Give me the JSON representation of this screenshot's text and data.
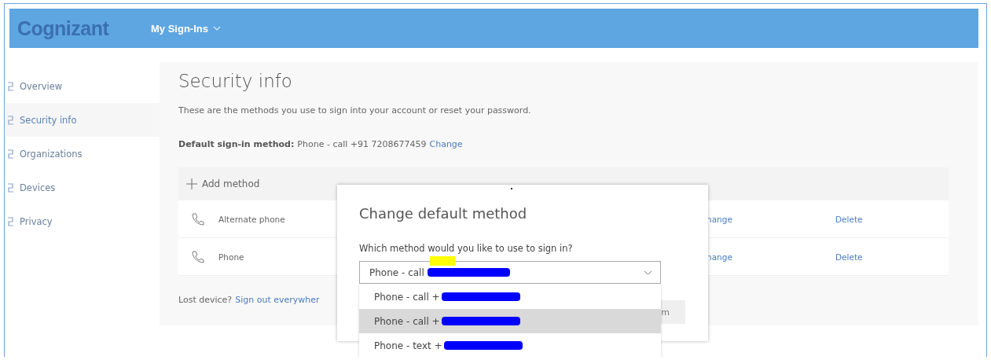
{
  "header": {
    "logo": "Cognizant",
    "app_menu": "My Sign-Ins"
  },
  "sidebar": {
    "items": [
      {
        "label": "Overview",
        "selected": false
      },
      {
        "label": "Security info",
        "selected": true
      },
      {
        "label": "Organizations",
        "selected": false
      },
      {
        "label": "Devices",
        "selected": false
      },
      {
        "label": "Privacy",
        "selected": false
      }
    ]
  },
  "main": {
    "title": "Security info",
    "description": "These are the methods you use to sign into your account or reset your password.",
    "default_method": {
      "label": "Default sign-in method:",
      "value": "Phone - call +91 7208677459",
      "link": "Change"
    },
    "add_method": "Add method",
    "methods": [
      {
        "name": "Alternate phone",
        "change": "hange",
        "delete": "Delete"
      },
      {
        "name": "Phone",
        "change": "hange",
        "delete": "Delete"
      }
    ],
    "lost_device": {
      "text": "Lost device?",
      "link": "Sign out everywher"
    }
  },
  "dialog": {
    "title": "Change default method",
    "question": "Which method would you like to use to sign in?",
    "select_value": "Phone - call",
    "select_redacted": true,
    "highlighted": true,
    "confirm_button": "m",
    "options": [
      {
        "label": "Phone - call +",
        "redacted": true,
        "selected": false
      },
      {
        "label": "Phone - call +",
        "redacted": true,
        "selected": true
      },
      {
        "label": "Phone - text +",
        "redacted": true,
        "selected": false
      }
    ]
  }
}
